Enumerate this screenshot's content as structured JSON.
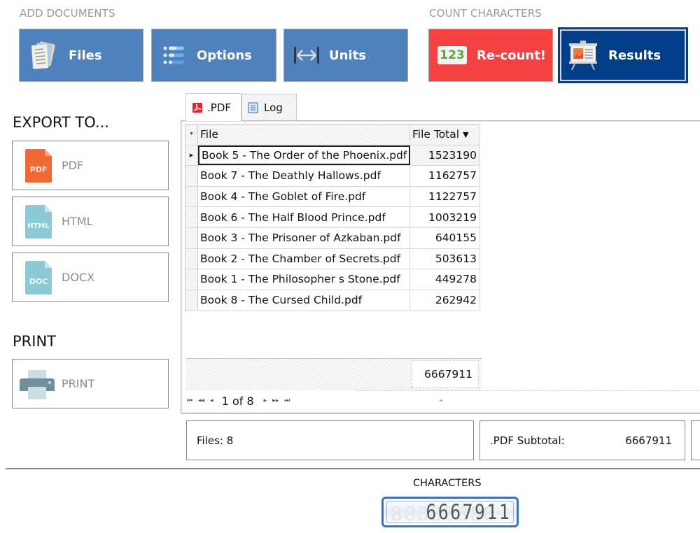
{
  "toolbar": {
    "add_documents_label": "ADD DOCUMENTS",
    "count_characters_label": "COUNT CHARACTERS",
    "buttons": {
      "files": "Files",
      "options": "Options",
      "units": "Units",
      "recount": "Re-count!",
      "recount_icon_text": "123",
      "results": "Results"
    },
    "colors": {
      "blue": "#4f82bd",
      "red": "#f44141",
      "navy": "#023f88"
    }
  },
  "sidebar": {
    "export_heading": "EXPORT TO...",
    "export_items": [
      {
        "label": "PDF",
        "icon_text": "PDF",
        "icon": "pdf-file-icon",
        "color": "#ef6a35"
      },
      {
        "label": "HTML",
        "icon_text": "HTML",
        "icon": "html-file-icon",
        "color": "#8ecad6"
      },
      {
        "label": "DOCX",
        "icon_text": "DOC",
        "icon": "doc-file-icon",
        "color": "#8ecad6"
      }
    ],
    "print_heading": "PRINT",
    "print_button": "PRINT"
  },
  "tabs": [
    {
      "label": ".PDF",
      "icon": "pdf-icon",
      "active": true
    },
    {
      "label": "Log",
      "icon": "log-icon",
      "active": false
    }
  ],
  "grid": {
    "new_row_marker": "*",
    "current_row_marker": "▸",
    "columns": {
      "file": "File",
      "total": "File Total",
      "sort": "▼"
    },
    "rows": [
      {
        "file": "Book 5 - The Order of the Phoenix.pdf",
        "total": "1523190"
      },
      {
        "file": "Book 7 - The Deathly Hallows.pdf",
        "total": "1162757"
      },
      {
        "file": "Book 4 - The Goblet of Fire.pdf",
        "total": "1122757"
      },
      {
        "file": "Book 6 - The Half Blood Prince.pdf",
        "total": "1003219"
      },
      {
        "file": "Book 3 - The Prisoner of Azkaban.pdf",
        "total": "640155"
      },
      {
        "file": "Book 2 - The Chamber of Secrets.pdf",
        "total": "503613"
      },
      {
        "file": "Book 1 - The Philosopher s Stone.pdf",
        "total": "449278"
      },
      {
        "file": "Book 8 - The Cursed Child.pdf",
        "total": "262942"
      }
    ],
    "footer_total": "6667911"
  },
  "pager": {
    "first": "⏮",
    "prev_page": "◂◂",
    "prev": "◂",
    "position": "1 of 8",
    "next": "▸",
    "next_page": "▸▸",
    "last": "⏭",
    "hscroll": "◂"
  },
  "stats": {
    "files": "Files: 8",
    "subtotal_label": ".PDF Subtotal:",
    "subtotal_value": "6667911"
  },
  "counter": {
    "label": "CHARACTERS",
    "value": "6667911",
    "ghost": "88888888"
  }
}
